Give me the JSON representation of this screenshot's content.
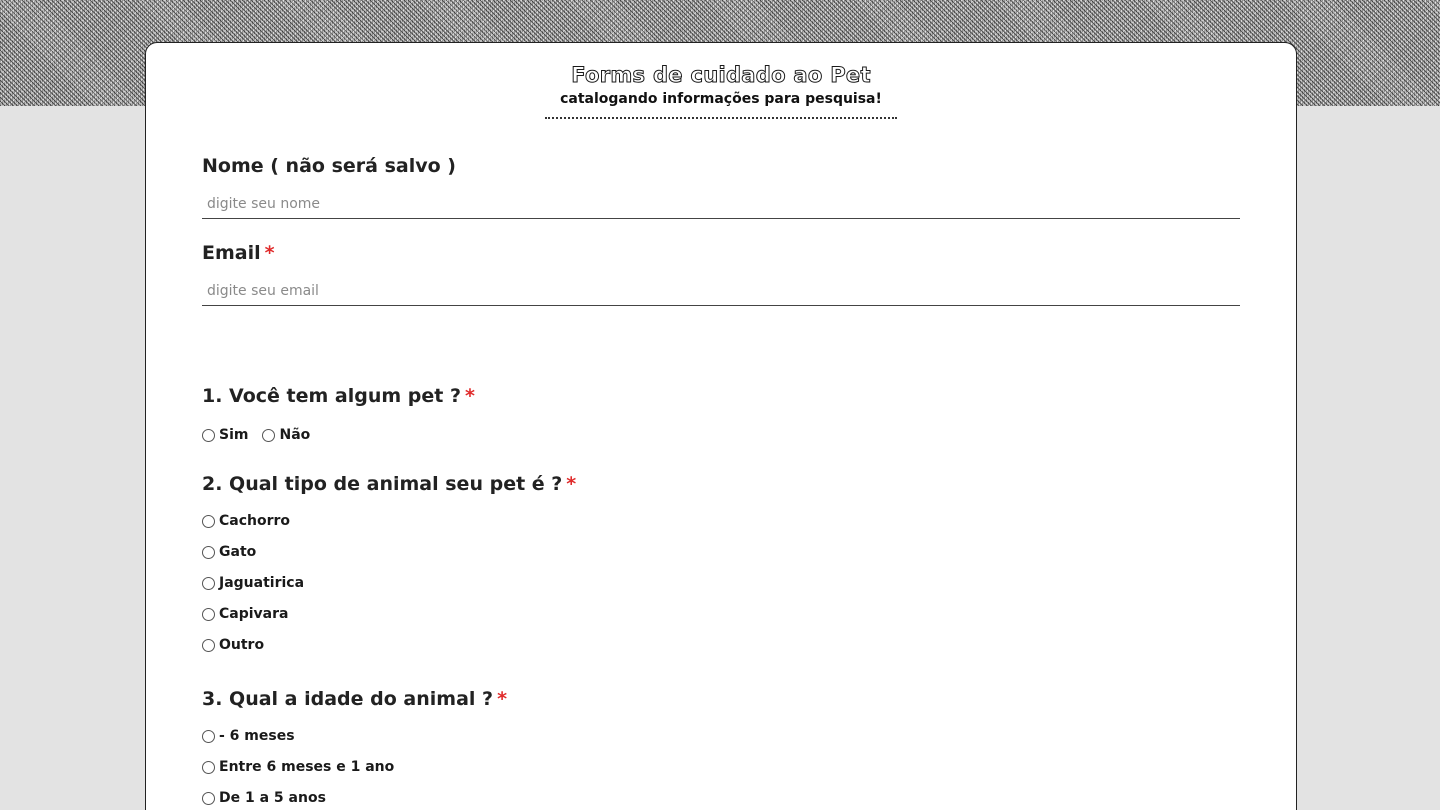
{
  "header": {
    "title": "Forms de cuidado ao Pet",
    "subtitle": "catalogando informações para pesquisa!"
  },
  "fields": {
    "nome": {
      "label": "Nome ( não será salvo )",
      "placeholder": "digite seu nome",
      "value": ""
    },
    "email": {
      "label": "Email",
      "required_mark": "*",
      "placeholder": "digite seu email",
      "value": ""
    }
  },
  "questions": [
    {
      "label": "1. Você tem algum pet ?",
      "required_mark": "*",
      "options": [
        "Sim",
        "Não"
      ]
    },
    {
      "label": "2. Qual tipo de animal seu pet é ?",
      "required_mark": "*",
      "options": [
        "Cachorro",
        "Gato",
        "Jaguatirica",
        "Capivara",
        "Outro"
      ]
    },
    {
      "label": "3. Qual a idade do animal ?",
      "required_mark": "*",
      "options": [
        "- 6 meses",
        "Entre 6 meses e 1 ano",
        "De 1 a 5 anos"
      ]
    }
  ],
  "colors": {
    "required": "#e02b2b",
    "background": "#e3e3e3",
    "card": "#ffffff"
  }
}
